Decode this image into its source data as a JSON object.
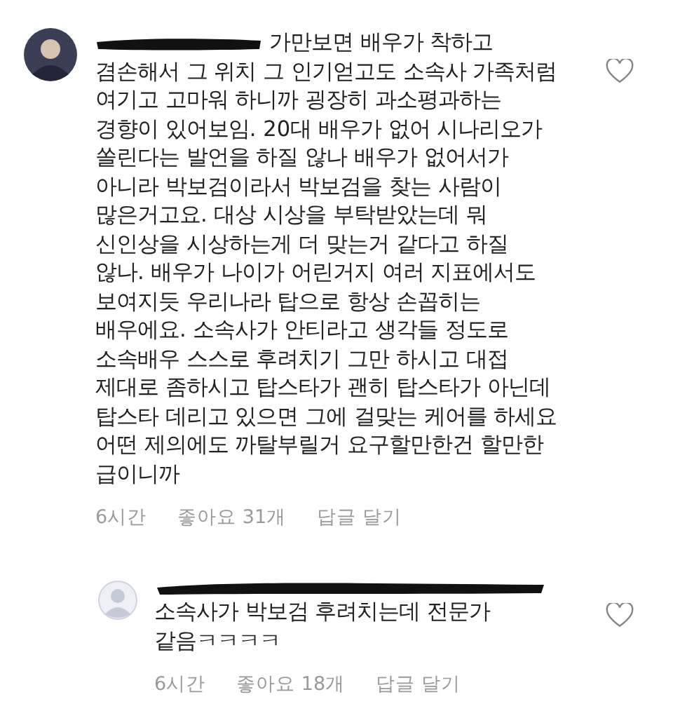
{
  "comments": [
    {
      "reply": false,
      "liked": false,
      "lines": [
        "가만보면 배우가 착하고",
        "겸손해서 그 위치 그 인기얻고도 소속사 가족처럼",
        "여기고 고마워 하니까 굉장히 과소평과하는",
        "경향이 있어보임. 20대 배우가 없어 시나리오가",
        "쏠린다는 발언을 하질 않나 배우가 없어서가",
        "아니라 박보검이라서 박보검을 찾는 사람이",
        "많은거고요. 대상 시상을 부탁받았는데 뭐",
        "신인상을 시상하는게 더 맞는거 같다고 하질",
        "않나. 배우가 나이가 어린거지 여러 지표에서도",
        "보여지듯 우리나라 탑으로 항상 손꼽히는",
        "배우에요. 소속사가 안티라고 생각들 정도로",
        "소속배우 스스로 후려치기 그만 하시고 대접",
        "제대로 좀하시고 탑스타가 괜히 탑스타가 아닌데",
        "탑스타 데리고 있으면 그에 걸맞는 케어를 하세요",
        "어떤 제의에도 까탈부릴거 요구할만한건 할만한",
        "급이니까"
      ],
      "time": "6시간",
      "likes": "좋아요 31개",
      "reply_label": "답글 달기"
    },
    {
      "reply": true,
      "liked": false,
      "lines": [
        "소속사가 박보검 후려치는데 전문가",
        "같음ㅋㅋㅋㅋ"
      ],
      "time": "6시간",
      "likes": "좋아요 18개",
      "reply_label": "답글 달기"
    }
  ]
}
